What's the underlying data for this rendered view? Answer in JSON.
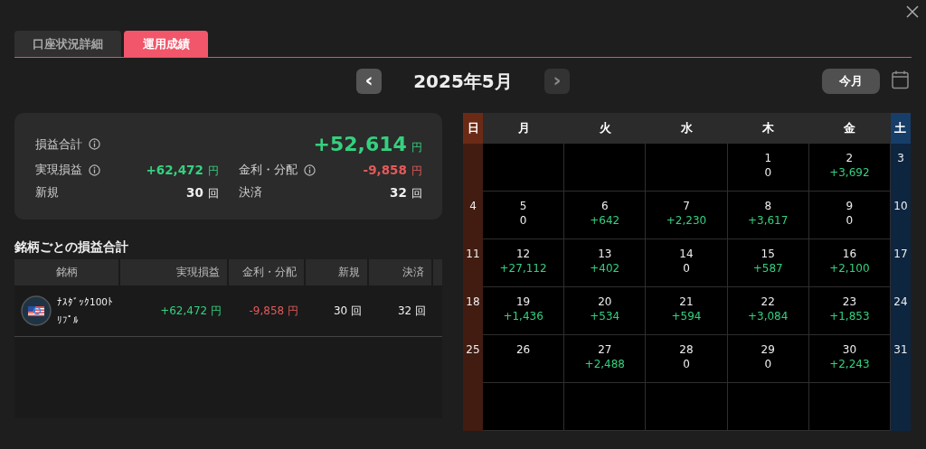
{
  "tabs": [
    {
      "label": "口座状況詳細",
      "selected": false
    },
    {
      "label": "運用成績",
      "selected": true
    }
  ],
  "month_nav": {
    "prev": "‹",
    "title": "2025年5月",
    "next": "›",
    "prev_disabled": false,
    "next_disabled": true,
    "today_button": "今月"
  },
  "summary": {
    "total": {
      "label": "損益合計",
      "info": true,
      "value": "+52,614",
      "unit": "円",
      "color": "#35d07f"
    },
    "items": [
      {
        "label": "実現損益",
        "info": true,
        "value": "+62,472",
        "unit": "円",
        "color": "#35d07f"
      },
      {
        "label": "金利・分配",
        "info": true,
        "value": "-9,858",
        "unit": "円",
        "color": "#e25a5a"
      },
      {
        "label": "新規",
        "info": false,
        "value": "30",
        "unit": "回",
        "color": "#f0f0f0"
      },
      {
        "label": "決済",
        "info": false,
        "value": "32",
        "unit": "回",
        "color": "#f0f0f0"
      }
    ]
  },
  "by_symbol": {
    "title": "銘柄ごとの損益合計",
    "columns": [
      "銘柄",
      "実現損益",
      "金利・分配",
      "新規",
      "決済"
    ],
    "rows": [
      {
        "cells": [
          {
            "kind": "symbol",
            "text": "ﾅｽﾀﾞｯｸ100ﾄﾘﾌﾟﾙ"
          },
          {
            "kind": "amount",
            "value": "+62,472",
            "unit": "円",
            "color": "#35d07f"
          },
          {
            "kind": "amount",
            "value": "-9,858",
            "unit": "円",
            "color": "#e25a5a"
          },
          {
            "kind": "amount",
            "value": "30",
            "unit": "回",
            "color": "#f0f0f0"
          },
          {
            "kind": "amount",
            "value": "32",
            "unit": "回",
            "color": "#f0f0f0"
          }
        ]
      }
    ]
  },
  "calendar": {
    "weekdays": [
      {
        "label": "日",
        "kind": "sunday"
      },
      {
        "label": "月",
        "kind": "weekday"
      },
      {
        "label": "火",
        "kind": "weekday"
      },
      {
        "label": "水",
        "kind": "weekday"
      },
      {
        "label": "木",
        "kind": "weekday"
      },
      {
        "label": "金",
        "kind": "weekday"
      },
      {
        "label": "土",
        "kind": "saturday"
      }
    ],
    "weeks": [
      [
        {
          "kind": "empty"
        },
        {
          "kind": "empty"
        },
        {
          "kind": "empty"
        },
        {
          "kind": "empty"
        },
        {
          "kind": "date",
          "day": "1",
          "pnl": "0",
          "color": "#f0f0f0"
        },
        {
          "kind": "date",
          "day": "2",
          "pnl": "+3,692",
          "color": "#35d07f"
        },
        {
          "kind": "date",
          "day": "3"
        }
      ],
      [
        {
          "kind": "date",
          "day": "4"
        },
        {
          "kind": "date",
          "day": "5",
          "pnl": "0",
          "color": "#f0f0f0"
        },
        {
          "kind": "date",
          "day": "6",
          "pnl": "+642",
          "color": "#35d07f"
        },
        {
          "kind": "date",
          "day": "7",
          "pnl": "+2,230",
          "color": "#35d07f"
        },
        {
          "kind": "date",
          "day": "8",
          "pnl": "+3,617",
          "color": "#35d07f"
        },
        {
          "kind": "date",
          "day": "9",
          "pnl": "0",
          "color": "#f0f0f0"
        },
        {
          "kind": "date",
          "day": "10"
        }
      ],
      [
        {
          "kind": "date",
          "day": "11"
        },
        {
          "kind": "date",
          "day": "12",
          "pnl": "+27,112",
          "color": "#35d07f"
        },
        {
          "kind": "date",
          "day": "13",
          "pnl": "+402",
          "color": "#35d07f"
        },
        {
          "kind": "date",
          "day": "14",
          "pnl": "0",
          "color": "#f0f0f0"
        },
        {
          "kind": "date",
          "day": "15",
          "pnl": "+587",
          "color": "#35d07f"
        },
        {
          "kind": "date",
          "day": "16",
          "pnl": "+2,100",
          "color": "#35d07f"
        },
        {
          "kind": "date",
          "day": "17"
        }
      ],
      [
        {
          "kind": "date",
          "day": "18"
        },
        {
          "kind": "date",
          "day": "19",
          "pnl": "+1,436",
          "color": "#35d07f"
        },
        {
          "kind": "date",
          "day": "20",
          "pnl": "+534",
          "color": "#35d07f"
        },
        {
          "kind": "date",
          "day": "21",
          "pnl": "+594",
          "color": "#35d07f"
        },
        {
          "kind": "date",
          "day": "22",
          "pnl": "+3,084",
          "color": "#35d07f"
        },
        {
          "kind": "date",
          "day": "23",
          "pnl": "+1,853",
          "color": "#35d07f"
        },
        {
          "kind": "date",
          "day": "24"
        }
      ],
      [
        {
          "kind": "date",
          "day": "25"
        },
        {
          "kind": "date",
          "day": "26"
        },
        {
          "kind": "date",
          "day": "27",
          "pnl": "+2,488",
          "color": "#35d07f"
        },
        {
          "kind": "date",
          "day": "28",
          "pnl": "0",
          "color": "#f0f0f0"
        },
        {
          "kind": "date",
          "day": "29",
          "pnl": "0",
          "color": "#f0f0f0"
        },
        {
          "kind": "date",
          "day": "30",
          "pnl": "+2,243",
          "color": "#35d07f"
        },
        {
          "kind": "date",
          "day": "31"
        }
      ],
      [
        {
          "kind": "empty"
        },
        {
          "kind": "empty"
        },
        {
          "kind": "empty"
        },
        {
          "kind": "empty"
        },
        {
          "kind": "empty"
        },
        {
          "kind": "empty"
        },
        {
          "kind": "empty"
        }
      ]
    ]
  }
}
